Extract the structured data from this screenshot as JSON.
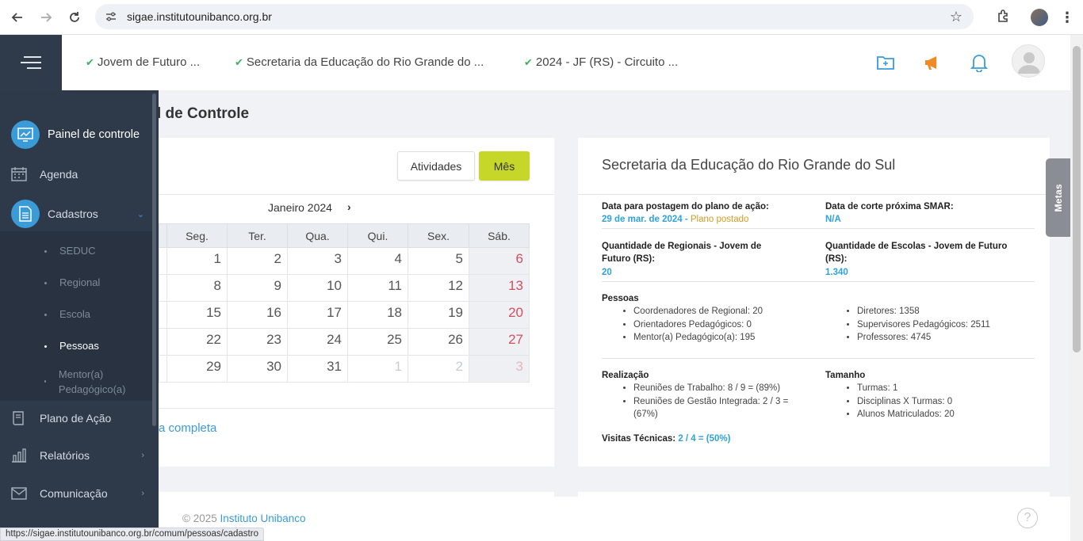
{
  "browser": {
    "url": "sigae.institutounibanco.org.br",
    "status_url": "https://sigae.institutounibanco.org.br/comum/pessoas/cadastro"
  },
  "header": {
    "breadcrumbs": [
      {
        "label": "Jovem de Futuro ..."
      },
      {
        "label": "Secretaria da Educação do Rio Grande do ..."
      },
      {
        "label": "2024 - JF (RS) - Circuito ..."
      }
    ],
    "accent_color": "#3a9bd7",
    "megaphone_color": "#f08a24"
  },
  "page": {
    "title_partial": "l de Controle"
  },
  "sidebar": {
    "items": [
      {
        "label": "Painel de controle",
        "icon": "chart-screen-icon"
      },
      {
        "label": "Agenda",
        "icon": "calendar-icon"
      },
      {
        "label": "Cadastros",
        "icon": "document-icon"
      },
      {
        "label": "Plano de Ação",
        "icon": "book-icon"
      },
      {
        "label": "Relatórios",
        "icon": "bar-chart-icon"
      },
      {
        "label": "Comunicação",
        "icon": "mail-icon"
      }
    ],
    "subitems": [
      {
        "label": "SEDUC"
      },
      {
        "label": "Regional"
      },
      {
        "label": "Escola"
      },
      {
        "label": "Pessoas"
      },
      {
        "label": "Mentor(a) Pedagógico(a)"
      }
    ]
  },
  "calendar": {
    "btn_atividades": "Atividades",
    "btn_mes": "Mês",
    "month": "Janeiro 2024",
    "weekdays": [
      "Seg.",
      "Ter.",
      "Qua.",
      "Qui.",
      "Sex.",
      "Sáb."
    ],
    "weeks": [
      [
        "1",
        "2",
        "3",
        "4",
        "5",
        "6"
      ],
      [
        "8",
        "9",
        "10",
        "11",
        "12",
        "13"
      ],
      [
        "15",
        "16",
        "17",
        "18",
        "19",
        "20"
      ],
      [
        "22",
        "23",
        "24",
        "25",
        "26",
        "27"
      ],
      [
        "29",
        "30",
        "31",
        "1",
        "2",
        "3"
      ]
    ],
    "link_partial": "a completa"
  },
  "info": {
    "title": "Secretaria da Educação do Rio Grande do Sul",
    "data_postagem_label": "Data para postagem do plano de ação:",
    "data_postagem_value": "29 de mar. de 2024 -",
    "data_postagem_status": "Plano postado",
    "data_corte_label": "Data de corte próxima SMAR:",
    "data_corte_value": "N/A",
    "qtd_regionais_label": "Quantidade de Regionais - Jovem de Futuro (RS):",
    "qtd_regionais_value": "20",
    "qtd_escolas_label": "Quantidade de Escolas - Jovem de Futuro (RS):",
    "qtd_escolas_value": "1.340",
    "pessoas_label": "Pessoas",
    "pessoas_left": [
      "Coordenadores de Regional: 20",
      "Orientadores Pedagógicos: 0",
      "Mentor(a) Pedagógico(a): 195"
    ],
    "pessoas_right": [
      "Diretores: 1358",
      "Supervisores Pedagógicos: 2511",
      "Professores: 4745"
    ],
    "realizacao_label": "Realização",
    "realizacao_items": [
      "Reuniões de Trabalho: 8 / 9 = (89%)",
      "Reuniões de Gestão Integrada: 2 / 3 = (67%)"
    ],
    "tamanho_label": "Tamanho",
    "tamanho_items": [
      "Turmas: 1",
      "Disciplinas X Turmas: 0",
      "Alunos Matriculados: 20"
    ],
    "visitas_label": "Visitas Técnicas:",
    "visitas_value": "2 / 4 = (50%)"
  },
  "metas_tab": "Metas",
  "footer": {
    "copyright": "© 2025",
    "org": "Instituto Unibanco"
  }
}
